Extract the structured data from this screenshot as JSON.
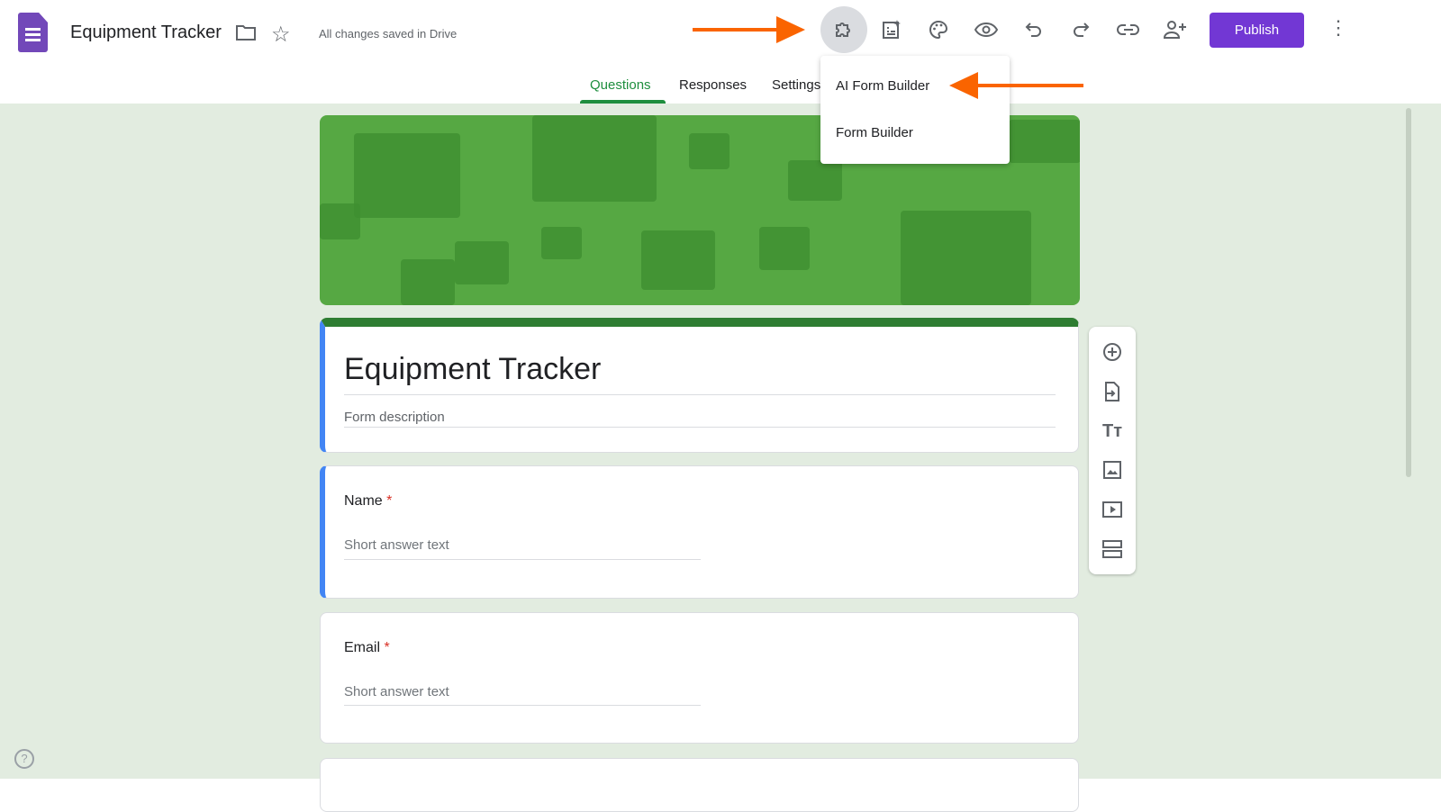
{
  "header": {
    "title": "Equipment Tracker",
    "saved_status": "All changes saved in Drive",
    "publish_label": "Publish"
  },
  "tabs": [
    {
      "label": "Questions"
    },
    {
      "label": "Responses"
    },
    {
      "label": "Settings"
    }
  ],
  "addon_menu": {
    "items": [
      {
        "label": "AI Form Builder"
      },
      {
        "label": "Form Builder"
      }
    ]
  },
  "form": {
    "title": "Equipment Tracker",
    "description_placeholder": "Form description",
    "questions": [
      {
        "label": "Name",
        "required": "*",
        "placeholder": "Short answer text"
      },
      {
        "label": "Email",
        "required": "*",
        "placeholder": "Short answer text"
      }
    ]
  },
  "colors": {
    "accent": "#7237d4",
    "tab_active": "#1e8e3e",
    "annotation_arrow": "#fa6400"
  }
}
